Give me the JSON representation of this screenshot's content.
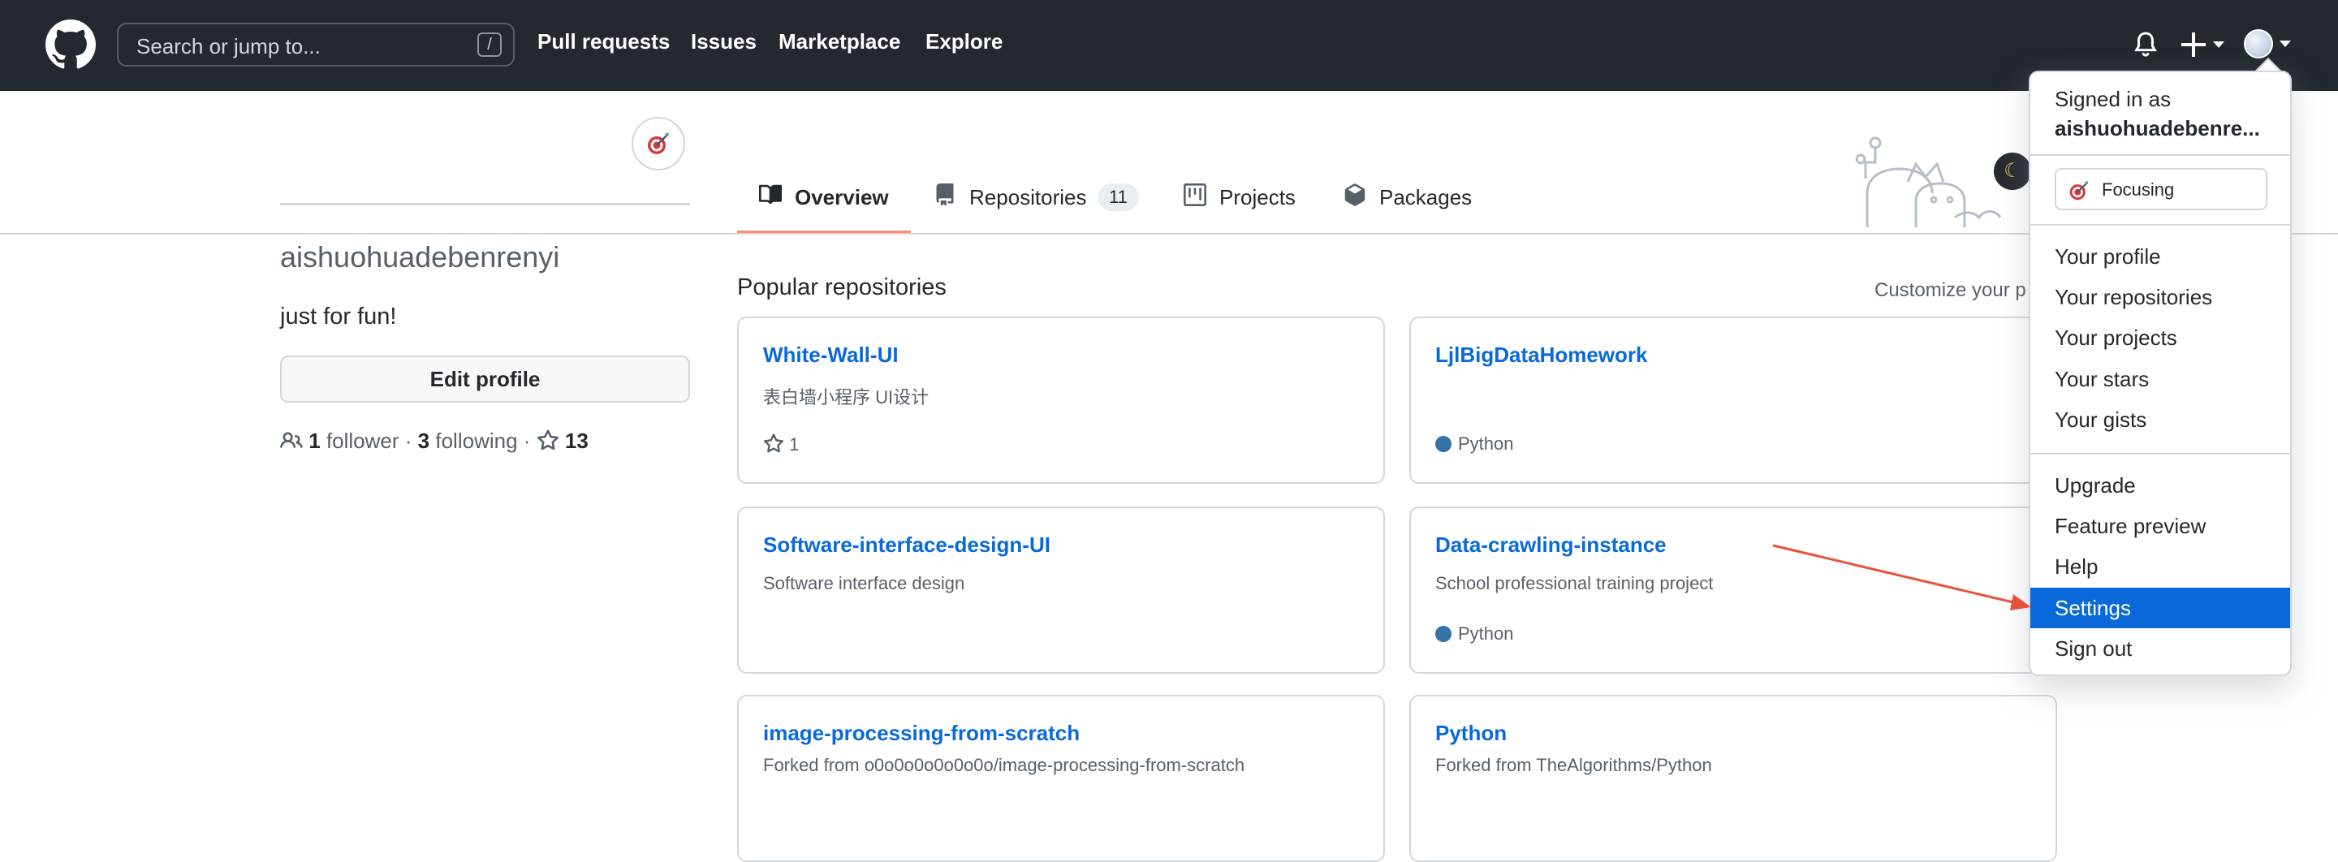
{
  "header": {
    "search_placeholder": "Search or jump to...",
    "search_shortcut": "/",
    "nav": [
      "Pull requests",
      "Issues",
      "Marketplace",
      "Explore"
    ]
  },
  "tabs": {
    "overview": "Overview",
    "repositories": "Repositories",
    "repositories_count": "11",
    "projects": "Projects",
    "packages": "Packages"
  },
  "profile": {
    "username": "aishuohuadebenrenyi",
    "bio": "just for fun!",
    "edit_profile": "Edit profile",
    "followers_count": "1",
    "followers_label": "follower",
    "following_count": "3",
    "following_label": "following",
    "stars_count": "13",
    "separator": "·"
  },
  "popular": {
    "title": "Popular repositories",
    "customize": "Customize your p",
    "repos": [
      {
        "name": "White-Wall-UI",
        "desc": "表白墙小程序 UI设计",
        "stars": "1"
      },
      {
        "name": "LjlBigDataHomework",
        "language": "Python"
      },
      {
        "name": "Software-interface-design-UI",
        "desc": "Software interface design"
      },
      {
        "name": "Data-crawling-instance",
        "desc": "School professional training project",
        "language": "Python"
      },
      {
        "name": "image-processing-from-scratch",
        "forked": "Forked from o0o0o0o0o0o0o/image-processing-from-scratch"
      },
      {
        "name": "Python",
        "forked": "Forked from TheAlgorithms/Python"
      }
    ]
  },
  "dropdown": {
    "signed_in_as": "Signed in as",
    "user": "aishuohuadebenre...",
    "status": "Focusing",
    "items_group1": [
      "Your profile",
      "Your repositories",
      "Your projects",
      "Your stars",
      "Your gists"
    ],
    "items_group2": [
      "Upgrade",
      "Feature preview",
      "Help",
      "Settings",
      "Sign out"
    ],
    "highlighted": "Settings"
  },
  "colors": {
    "header_bg": "#24292f",
    "link": "#0969da",
    "highlight": "#0969da",
    "python": "#3572A5",
    "tab_underline": "#fd8c73",
    "annotation_arrow": "#e5533c"
  },
  "icons": [
    "github-logo-icon",
    "bell-icon",
    "plus-icon",
    "book-icon",
    "repo-icon",
    "project-icon",
    "package-icon",
    "people-icon",
    "star-icon",
    "moon-icon",
    "focus-emoji-icon"
  ]
}
